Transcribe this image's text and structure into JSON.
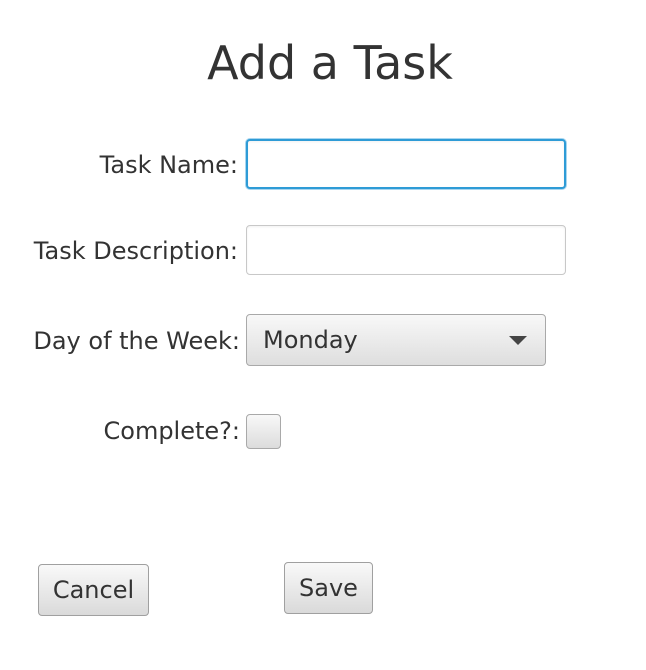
{
  "window": {
    "title": "Add a Task"
  },
  "form": {
    "task_name": {
      "label": "Task Name:",
      "value": "",
      "placeholder": ""
    },
    "task_description": {
      "label": "Task Description:",
      "value": "",
      "placeholder": ""
    },
    "day_of_week": {
      "label": "Day of the Week:",
      "selected": "Monday"
    },
    "complete": {
      "label": "Complete?:",
      "checked": false
    }
  },
  "actions": {
    "cancel_label": "Cancel",
    "save_label": "Save"
  },
  "icons": {
    "dropdown": "chevron-down-icon"
  },
  "colors": {
    "focus_ring": "#2e9bd6",
    "text": "#333333",
    "background": "#ffffff"
  }
}
